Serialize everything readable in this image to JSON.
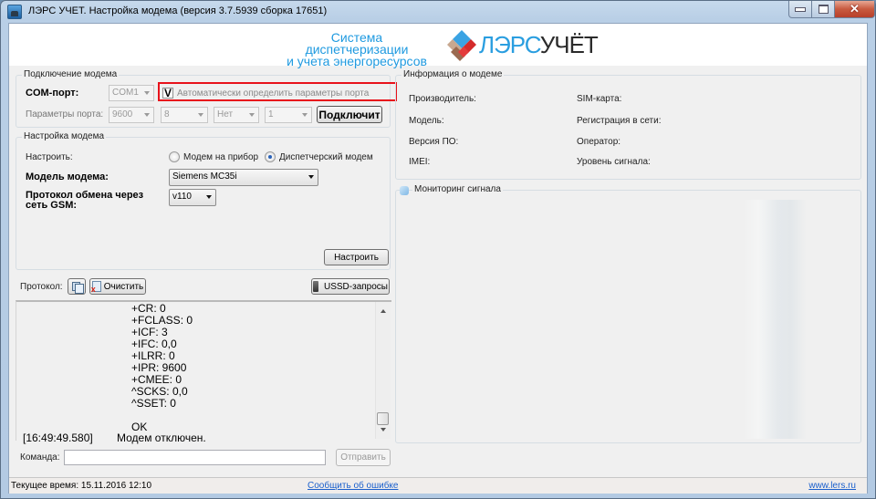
{
  "window": {
    "title": "ЛЭРС УЧЕТ. Настройка модема (версия 3.7.5939 сборка 17651)"
  },
  "header": {
    "slogan_line1": "Система диспетчеризации",
    "slogan_line2": "и учета энергоресурсов",
    "brand_part1": "ЛЭРС",
    "brand_part2": "УЧЁТ"
  },
  "connection": {
    "legend": "Подключение модема",
    "com_port_label": "COM-порт:",
    "com_port_value": "COM1",
    "auto_detect_checked": true,
    "auto_detect_mark": "V",
    "auto_detect_label": "Автоматически определить параметры порта",
    "port_params_label": "Параметры порта:",
    "baud_rate": "9600",
    "data_bits": "8",
    "parity": "Нет",
    "stop_bits": "1",
    "connect_button": "Подключит"
  },
  "modem_setup": {
    "legend": "Настройка модема",
    "configure_label": "Настроить:",
    "radio_device_label": "Модем на прибор",
    "radio_dispatch_label": "Диспетчерский модем",
    "selected_mode": "Диспетчерский модем",
    "model_label": "Модель модема:",
    "model_value": "Siemens MC35i",
    "protocol_label_line1": "Протокол обмена через",
    "protocol_label_line2": "сеть GSM:",
    "protocol_value": "v110",
    "setup_button": "Настроить"
  },
  "log": {
    "label": "Протокол:",
    "clear_button": "Очистить",
    "ussd_button": "USSD-запросы",
    "lines": [
      "+CR: 0",
      "+FCLASS: 0",
      "+ICF: 3",
      "+IFC: 0,0",
      "+ILRR: 0",
      "+IPR: 9600",
      "+CMEE: 0",
      "^SCKS: 0,0",
      "^SSET: 0",
      "",
      "OK"
    ],
    "last_entry_time": "[16:49:49.580]",
    "last_entry_text": "Модем отключен.",
    "command_label": "Команда:",
    "command_value": "",
    "send_button": "Отправить"
  },
  "modem_info": {
    "legend": "Информация о модеме",
    "left_fields": [
      "Производитель:",
      "Модель:",
      "Версия ПО:",
      "IMEI:"
    ],
    "right_fields": [
      "SIM-карта:",
      "Регистрация в сети:",
      "Оператор:",
      "Уровень сигнала:"
    ]
  },
  "signal_monitor": {
    "legend": "Мониторинг сигнала"
  },
  "status": {
    "current_time": "Текущее время: 15.11.2016 12:10",
    "report_link": "Сообщить об ошибке",
    "website_link": "www.lers.ru"
  },
  "colors": {
    "accent_blue": "#1f9ae0",
    "highlight_red": "#e8121b",
    "link_blue": "#1a5fcc"
  }
}
